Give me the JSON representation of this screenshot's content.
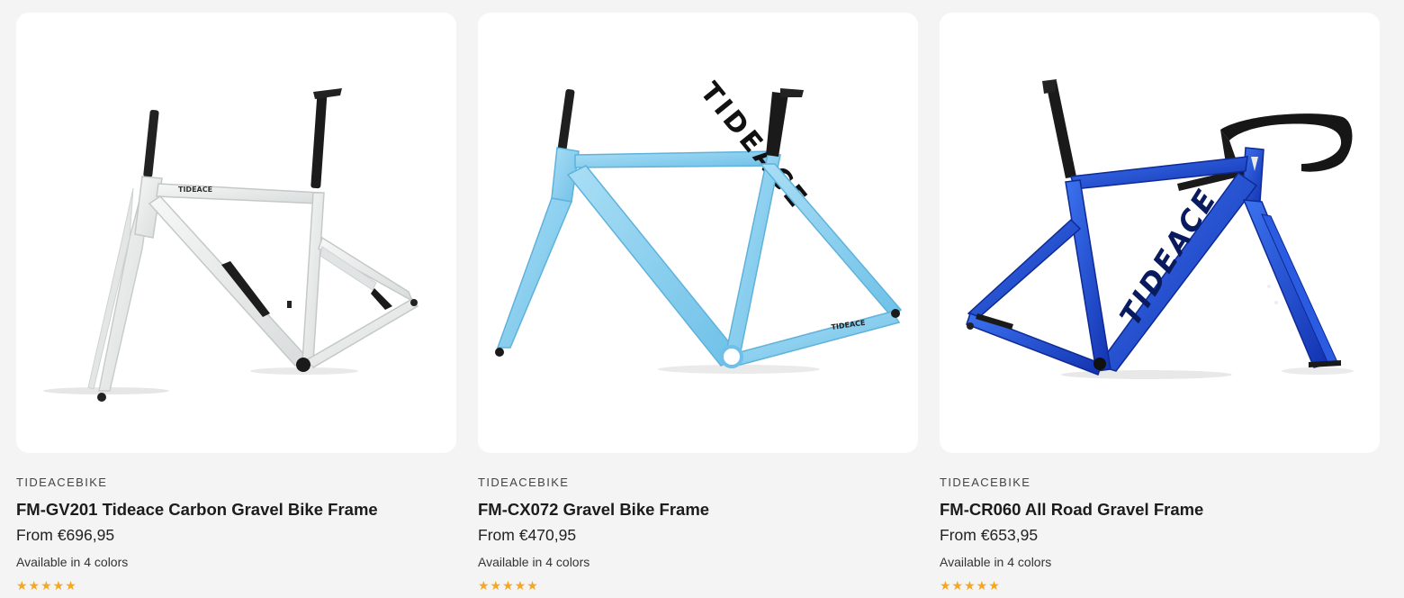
{
  "products": [
    {
      "vendor": "TIDEACEBIKE",
      "title": "FM-GV201 Tideace Carbon Gravel Bike Frame",
      "price_prefix": "From",
      "price": "€696,95",
      "availability": "Available in 4 colors",
      "rating_stars": "★★★★★",
      "rating": 5,
      "frame_color": "#eceeee",
      "frame_logo": "TIDEACE",
      "image_icon": "bike-frame-white-icon"
    },
    {
      "vendor": "TIDEACEBIKE",
      "title": "FM-CX072 Gravel Bike Frame",
      "price_prefix": "From",
      "price": "€470,95",
      "availability": "Available in 4 colors",
      "rating_stars": "★★★★★",
      "rating": 5,
      "frame_color": "#8fd0ee",
      "frame_logo": "TIDEACE",
      "image_icon": "bike-frame-light-blue-icon"
    },
    {
      "vendor": "TIDEACEBIKE",
      "title": "FM-CR060 All Road Gravel Frame",
      "price_prefix": "From",
      "price": "€653,95",
      "availability": "Available in 4 colors",
      "rating_stars": "★★★★★",
      "rating": 5,
      "frame_color": "#1f4fd6",
      "frame_logo": "TIDEACE",
      "image_icon": "bike-frame-blue-icon"
    }
  ],
  "colors": {
    "page_background": "#f4f4f4",
    "card_background": "#ffffff",
    "star": "#f5a623"
  }
}
